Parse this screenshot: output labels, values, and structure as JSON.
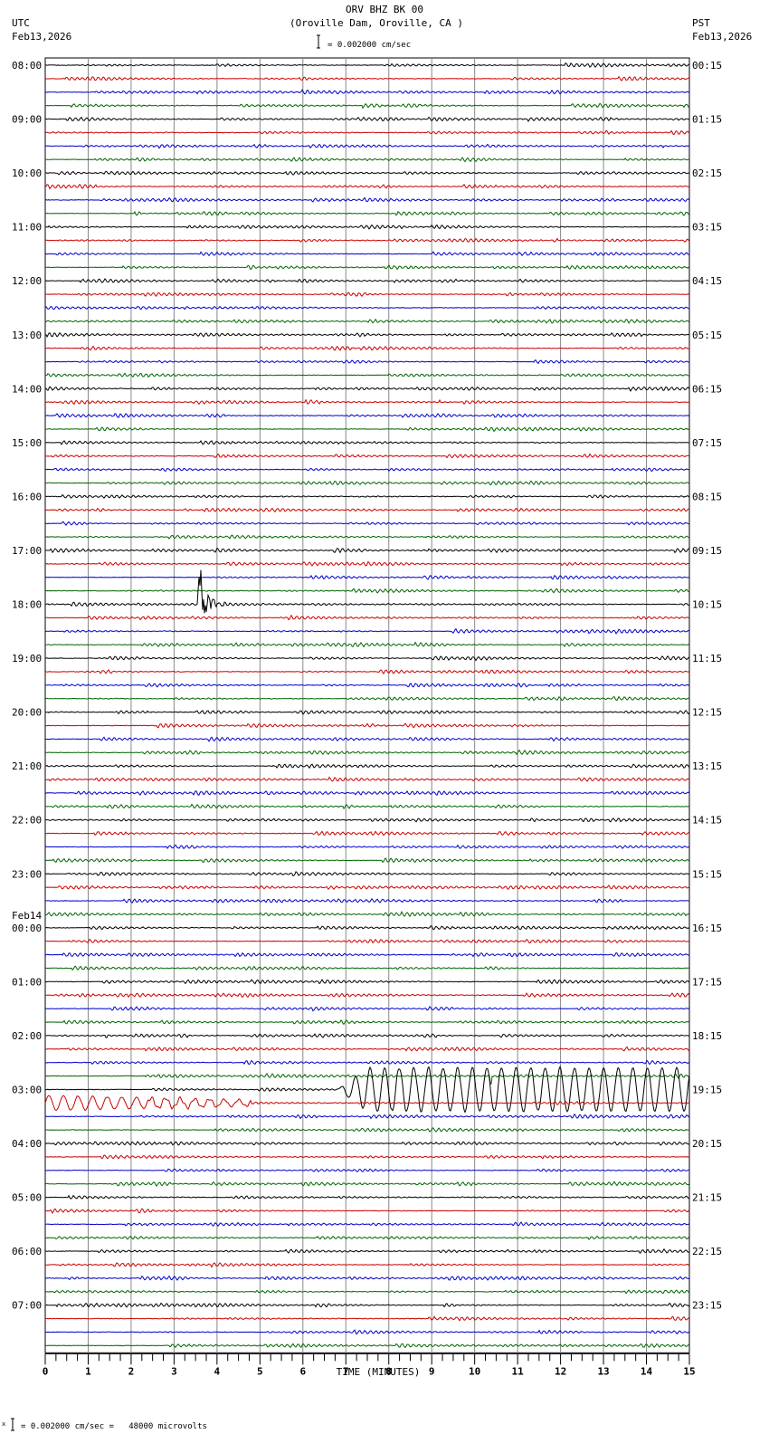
{
  "header": {
    "title": "ORV BHZ BK 00",
    "subtitle": "(Oroville Dam, Oroville, CA )",
    "left_tz": "UTC",
    "left_date": "Feb13,2026",
    "right_tz": "PST",
    "right_date": "Feb13,2026",
    "scale_text": "= 0.002000 cm/sec"
  },
  "footer": {
    "scale_text": "= 0.002000 cm/sec =   48000 microvolts",
    "marker": "x"
  },
  "chart_data": {
    "type": "line",
    "subtype": "helicorder",
    "title": "ORV BHZ BK 00",
    "xlabel": "TIME (MINUTES)",
    "xlim": [
      0,
      15
    ],
    "x_ticks": [
      "0",
      "1",
      "2",
      "3",
      "4",
      "5",
      "6",
      "7",
      "8",
      "9",
      "10",
      "11",
      "12",
      "13",
      "14",
      "15"
    ],
    "minor_tick_step_minutes": 0.25,
    "traces_per_hour": 4,
    "trace_colors": [
      "#000000",
      "#cc0000",
      "#0000cc",
      "#006600"
    ],
    "left_labels": [
      "08:00",
      "09:00",
      "10:00",
      "11:00",
      "12:00",
      "13:00",
      "14:00",
      "15:00",
      "16:00",
      "17:00",
      "18:00",
      "19:00",
      "20:00",
      "21:00",
      "22:00",
      "23:00",
      "00:00",
      "01:00",
      "02:00",
      "03:00",
      "04:00",
      "05:00",
      "06:00",
      "07:00"
    ],
    "left_date_change": {
      "hour_index": 16,
      "label": "Feb14"
    },
    "right_labels": [
      "00:15",
      "01:15",
      "02:15",
      "03:15",
      "04:15",
      "05:15",
      "06:15",
      "07:15",
      "08:15",
      "09:15",
      "10:15",
      "11:15",
      "12:15",
      "13:15",
      "14:15",
      "15:15",
      "16:15",
      "17:15",
      "18:15",
      "19:15",
      "20:15",
      "21:15",
      "22:15",
      "23:15"
    ],
    "events": [
      {
        "trace": "18:00",
        "start_min": 3.55,
        "end_min": 4.2,
        "amplitude_units": 4.0,
        "type": "local earthquake"
      },
      {
        "trace": "02:45",
        "start_min": 10.35,
        "end_min": 10.9,
        "amplitude_units": 0.7,
        "type": "spike"
      },
      {
        "trace": "03:00",
        "start_min": 6.8,
        "end_min": 15,
        "amplitude_units": 2.0,
        "period_min": 0.34,
        "type": "teleseism"
      },
      {
        "trace": "03:15",
        "start_min": 0,
        "end_min": 4.8,
        "amplitude_units": 0.7,
        "period_min": 0.34,
        "type": "teleseism coda"
      }
    ]
  }
}
